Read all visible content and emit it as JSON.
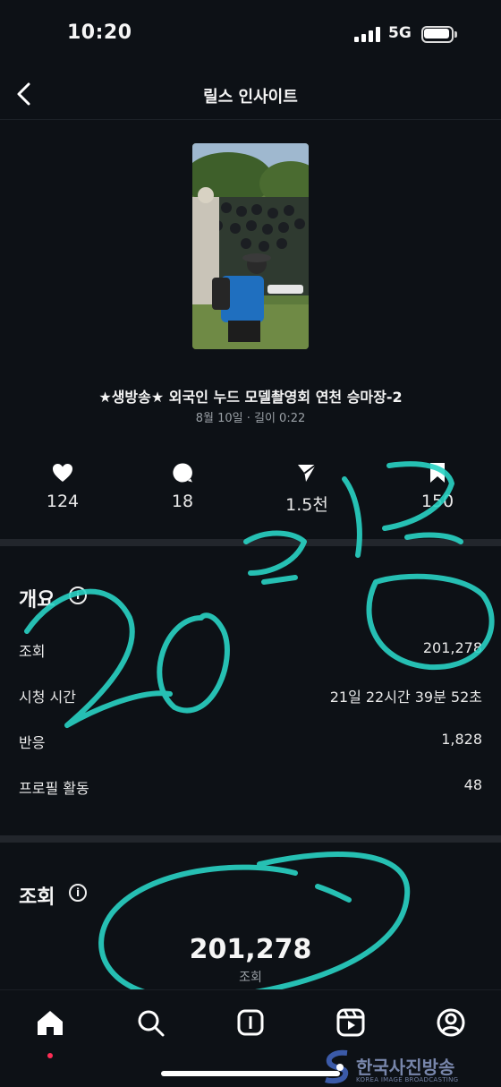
{
  "status_bar": {
    "time": "10:20",
    "network": "5G"
  },
  "header": {
    "title": "릴스 인사이트"
  },
  "reel": {
    "title": "★생방송★ 외국인 누드 모델촬영회 연천 승마장-2",
    "meta": "8월 10일 · 길이 0:22"
  },
  "stats": [
    {
      "icon": "heart-icon",
      "value": "124"
    },
    {
      "icon": "comment-icon",
      "value": "18"
    },
    {
      "icon": "share-icon",
      "value": "1.5천"
    },
    {
      "icon": "bookmark-icon",
      "value": "150"
    }
  ],
  "overview": {
    "title": "개요",
    "rows": [
      {
        "label": "조회",
        "value": "201,278"
      },
      {
        "label": "시청 시간",
        "value": "21일 22시간 39분 52초"
      },
      {
        "label": "반응",
        "value": "1,828"
      },
      {
        "label": "프로필 활동",
        "value": "48"
      }
    ]
  },
  "views": {
    "title": "조회",
    "number": "201,278",
    "caption": "조회"
  },
  "bottom_nav": [
    "home-icon",
    "search-icon",
    "create-icon",
    "reels-icon",
    "profile-icon"
  ],
  "watermark": {
    "text": "한국사진방송",
    "sub": "KOREA IMAGE BROADCASTING"
  },
  "colors": {
    "background": "#0d1116",
    "scribble": "#29d3c4",
    "notification_dot": "#ff2d55"
  }
}
